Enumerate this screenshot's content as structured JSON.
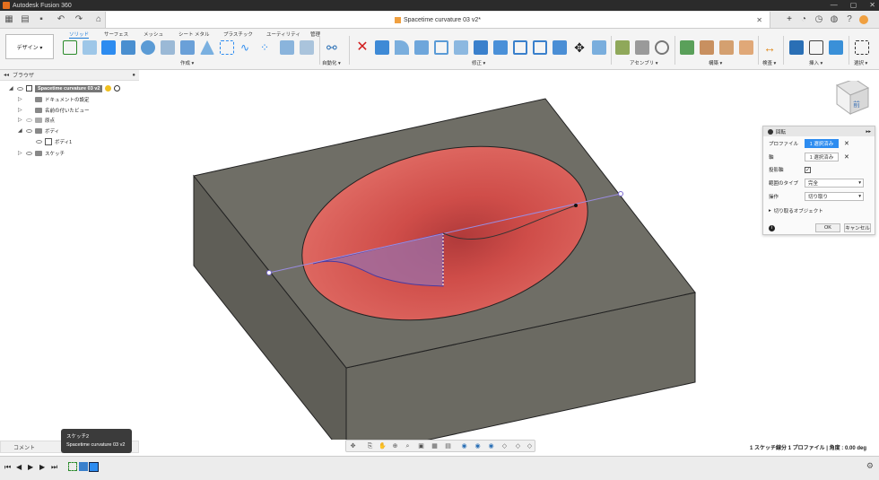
{
  "window": {
    "app_title": "Autodesk Fusion 360",
    "min": "—",
    "max": "▢",
    "close": "✕"
  },
  "document": {
    "tab_title": "Spacetime curvature 03 v2*",
    "close": "✕"
  },
  "toolbar": {
    "workspace": "デザイン ▾",
    "tabs": [
      "ソリッド",
      "サーフェス",
      "メッシュ",
      "シート メタル",
      "プラスチック",
      "ユーティリティ",
      "管理"
    ],
    "groups": [
      "作成 ▾",
      "自動化 ▾",
      "修正 ▾",
      "アセンブリ ▾",
      "構築 ▾",
      "検査 ▾",
      "挿入 ▾",
      "選択 ▾"
    ]
  },
  "browser": {
    "title": "ブラウザ",
    "root": "Spacetime curvature 03 v2",
    "items": [
      "ドキュメントの設定",
      "名前の付いたビュー",
      "原点",
      "ボディ",
      "ボディ1",
      "スケッチ"
    ]
  },
  "panel": {
    "title": "回転",
    "profile_label": "プロファイル",
    "profile_value": "1 選択済み",
    "axis_label": "軸",
    "axis_value": "1 選択済み",
    "project_axis_label": "投影軸",
    "extent_label": "範囲のタイプ",
    "extent_value": "完全",
    "operation_label": "操作",
    "operation_value": "切り取り",
    "objects_label": "切り取るオブジェクト",
    "ok": "OK",
    "cancel": "キャンセル",
    "x": "✕"
  },
  "status": {
    "text": "1 スケッチ線分 1 プロファイル | 角度 : 0.00 deg"
  },
  "comment": {
    "label": "コメント"
  },
  "tooltip": {
    "line1": "スケッチ2",
    "line2": "Spacetime curvature 03 v2"
  },
  "viewcube": {
    "face": "前"
  },
  "colors": {
    "accent": "#1a7ad8",
    "body": "#6b6a62",
    "cavity": "#d9534f",
    "selected": "#2d8cf0"
  }
}
